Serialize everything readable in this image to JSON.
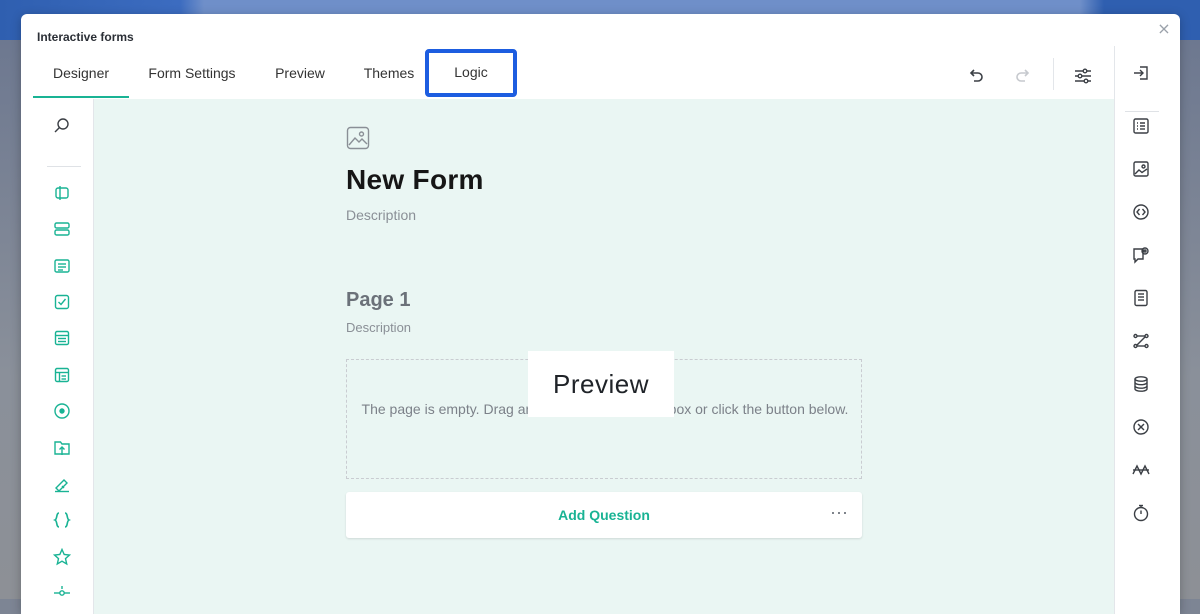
{
  "dialog": {
    "title": "Interactive forms",
    "close_glyph": "×",
    "close_icon": "close-icon"
  },
  "tabs": [
    {
      "label": "Designer",
      "active": true
    },
    {
      "label": "Form Settings",
      "active": false
    },
    {
      "label": "Preview",
      "active": false
    },
    {
      "label": "Themes",
      "active": false
    },
    {
      "label": "Logic",
      "active": false,
      "highlighted": true
    }
  ],
  "toolbar": {
    "icons": [
      "undo-icon",
      "redo-icon",
      "settings-sliders-icon"
    ]
  },
  "left_toolbox": {
    "icons": [
      "search-icon",
      "text-input-icon",
      "multiple-text-icon",
      "comment-icon",
      "checkbox-icon",
      "matrix-icon",
      "matrix-dropdown-icon",
      "radiogroup-icon",
      "file-upload-icon",
      "signature-icon",
      "expression-icon",
      "rating-icon",
      "slider-icon"
    ]
  },
  "right_toolbar": {
    "icons": [
      "collapse-panel-icon",
      "general-icon",
      "logo-image-icon",
      "navigation-icon",
      "question-settings-icon",
      "pages-icon",
      "logic-icon",
      "data-icon",
      "validation-icon",
      "conditions-icon",
      "timer-icon"
    ]
  },
  "form": {
    "title": "New Form",
    "description": "Description",
    "logo_placeholder_icon": "image-placeholder-icon",
    "page": {
      "title": "Page 1",
      "description": "Description",
      "empty_message": "The page is empty. Drag an element from the toolbox or click the button below.",
      "add_question_label": "Add Question",
      "more_label": "···"
    }
  },
  "overlay": {
    "label": "Preview"
  },
  "colors": {
    "accent": "#19b394",
    "highlight_border": "#1d5de0",
    "canvas_background": "#eaf6f3"
  }
}
